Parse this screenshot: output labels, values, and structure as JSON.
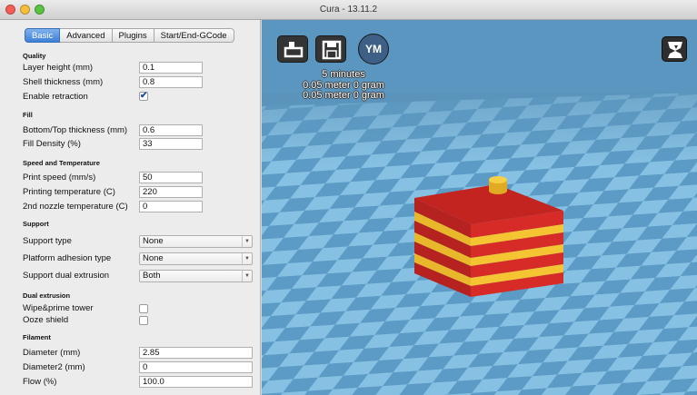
{
  "window": {
    "title": "Cura - 13.11.2"
  },
  "tabs": [
    {
      "label": "Basic",
      "active": true
    },
    {
      "label": "Advanced",
      "active": false
    },
    {
      "label": "Plugins",
      "active": false
    },
    {
      "label": "Start/End-GCode",
      "active": false
    }
  ],
  "quality": {
    "header": "Quality",
    "layer_height": {
      "label": "Layer height (mm)",
      "value": "0.1"
    },
    "shell_thickness": {
      "label": "Shell thickness (mm)",
      "value": "0.8"
    },
    "retraction": {
      "label": "Enable retraction",
      "checked": true,
      "mark": "✔"
    }
  },
  "fill": {
    "header": "Fill",
    "bottom_top": {
      "label": "Bottom/Top thickness (mm)",
      "value": "0.6"
    },
    "density": {
      "label": "Fill Density (%)",
      "value": "33"
    }
  },
  "speed": {
    "header": "Speed and Temperature",
    "print_speed": {
      "label": "Print speed (mm/s)",
      "value": "50"
    },
    "print_temp": {
      "label": "Printing temperature (C)",
      "value": "220"
    },
    "nozzle2_temp": {
      "label": "2nd nozzle temperature (C)",
      "value": "0"
    }
  },
  "support": {
    "header": "Support",
    "type": {
      "label": "Support type",
      "value": "None"
    },
    "adhesion": {
      "label": "Platform adhesion type",
      "value": "None"
    },
    "dual": {
      "label": "Support dual extrusion",
      "value": "Both"
    },
    "arrow": "▼"
  },
  "dual_extrusion": {
    "header": "Dual extrusion",
    "wipe": {
      "label": "Wipe&prime tower",
      "checked": false
    },
    "ooze": {
      "label": "Ooze shield",
      "checked": false
    }
  },
  "filament": {
    "header": "Filament",
    "diameter": {
      "label": "Diameter (mm)",
      "value": "2.85"
    },
    "diameter2": {
      "label": "Diameter2 (mm)",
      "value": "0"
    },
    "flow": {
      "label": "Flow (%)",
      "value": "100.0"
    }
  },
  "viewport": {
    "print_time": "5 minutes",
    "filament_line1": "0.05 meter 0 gram",
    "filament_line2": "0.05 meter 0 gram",
    "ym_label": "YM",
    "icons": [
      "load-file-icon",
      "save-icon",
      "youmagine-icon",
      "view-mode-icon"
    ],
    "colors": {
      "red": "#cf2a26",
      "yellow": "#f2c230",
      "floor_light": "#7cb8db",
      "floor_dark": "#5d9cc7"
    }
  }
}
